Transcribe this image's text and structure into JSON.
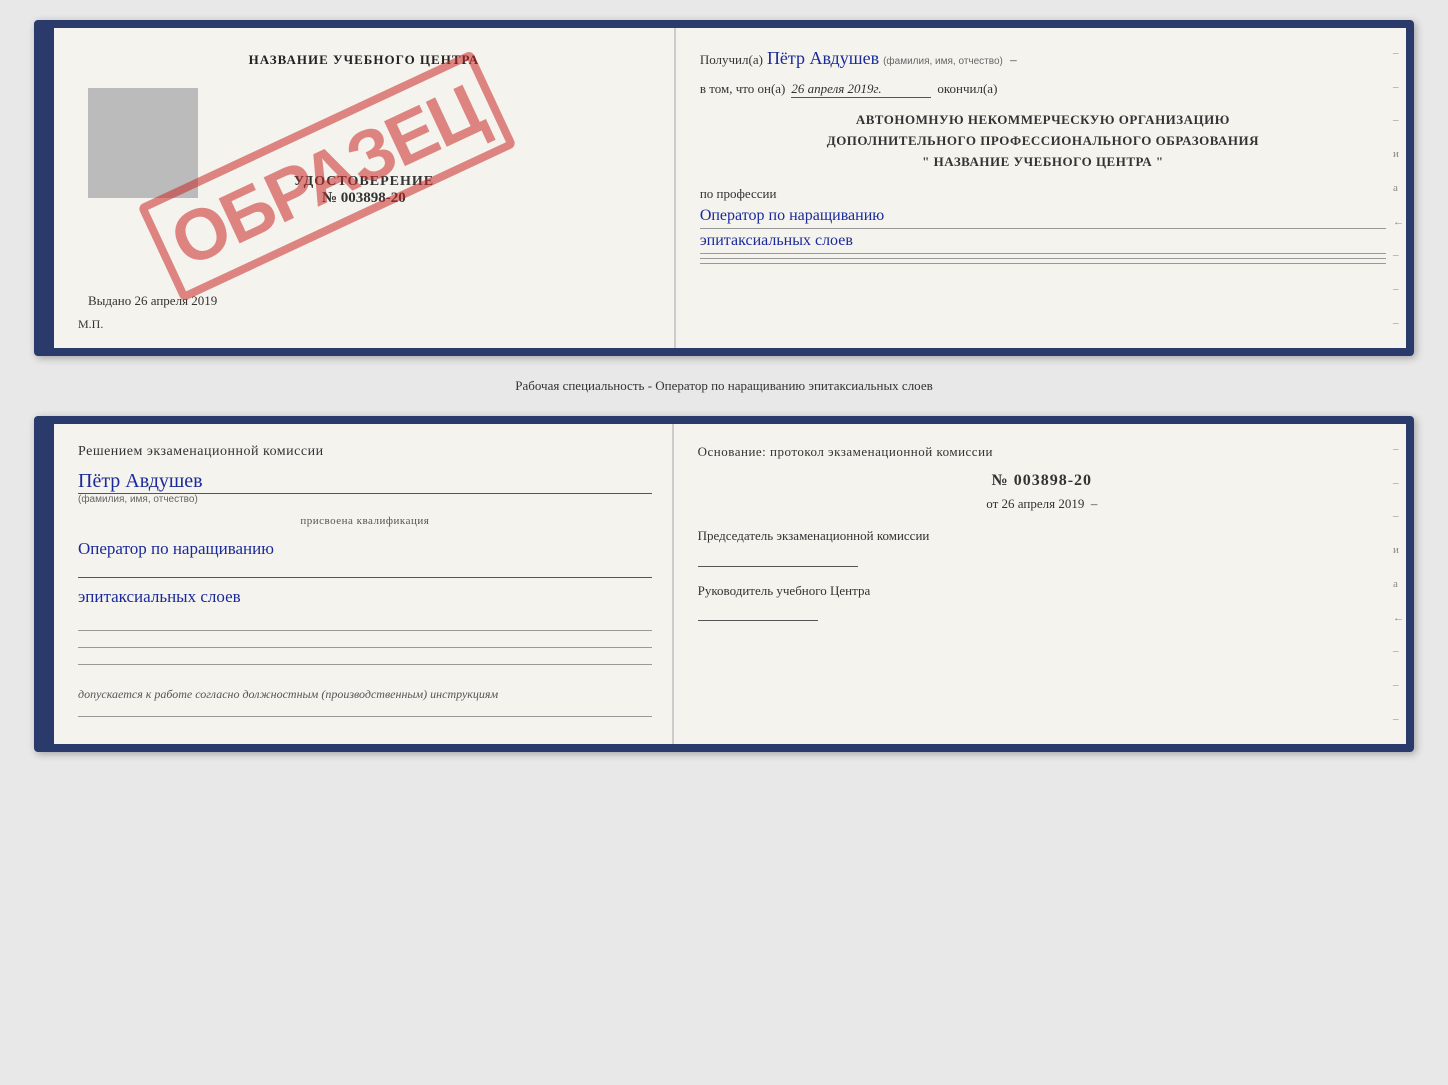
{
  "top_card": {
    "left": {
      "center_title": "НАЗВАНИЕ УЧЕБНОГО ЦЕНТРА",
      "stamp": "ОБРАЗЕЦ",
      "udostoverenie_label": "УДОСТОВЕРЕНИЕ",
      "number": "№ 003898-20",
      "vydano_label": "Выдано",
      "vydano_date": "26 апреля 2019",
      "mp": "М.П."
    },
    "right": {
      "poluchil_prefix": "Получил(а)",
      "poluchil_name": "Пётр Авдушев",
      "familiya_hint": "(фамилия, имя, отчество)",
      "vtom_prefix": "в том, что он(а)",
      "vtom_date": "26 апреля 2019г.",
      "okonchil": "окончил(а)",
      "org_line1": "АВТОНОМНУЮ НЕКОММЕРЧЕСКУЮ ОРГАНИЗАЦИЮ",
      "org_line2": "ДОПОЛНИТЕЛЬНОГО ПРОФЕССИОНАЛЬНОГО ОБРАЗОВАНИЯ",
      "org_line3": "\"  НАЗВАНИЕ УЧЕБНОГО ЦЕНТРА  \"",
      "po_professii_label": "по профессии",
      "professiya_line1": "Оператор по наращиванию",
      "professiya_line2": "эпитаксиальных слоев"
    }
  },
  "specialty_text": "Рабочая специальность - Оператор по наращиванию эпитаксиальных слоев",
  "bottom_card": {
    "left": {
      "resheniem_text": "Решением  экзаменационной  комиссии",
      "name": "Пётр Авдушев",
      "familiya_hint": "(фамилия, имя, отчество)",
      "prisvoyena_label": "присвоена квалификация",
      "kval_line1": "Оператор по наращиванию",
      "kval_line2": "эпитаксиальных слоев",
      "dopuskaetsya_text": "допускается к  работе согласно должностным (производственным) инструкциям"
    },
    "right": {
      "osnovanie_text": "Основание: протокол экзаменационной  комиссии",
      "protocol_num": "№  003898-20",
      "ot_label": "от",
      "ot_date": "26 апреля 2019",
      "predsedatel_text": "Председатель экзаменационной комиссии",
      "rukovoditel_text": "Руководитель учебного Центра"
    }
  },
  "side_chars": [
    "–",
    "–",
    "и",
    "а",
    "←",
    "–",
    "–",
    "–"
  ]
}
